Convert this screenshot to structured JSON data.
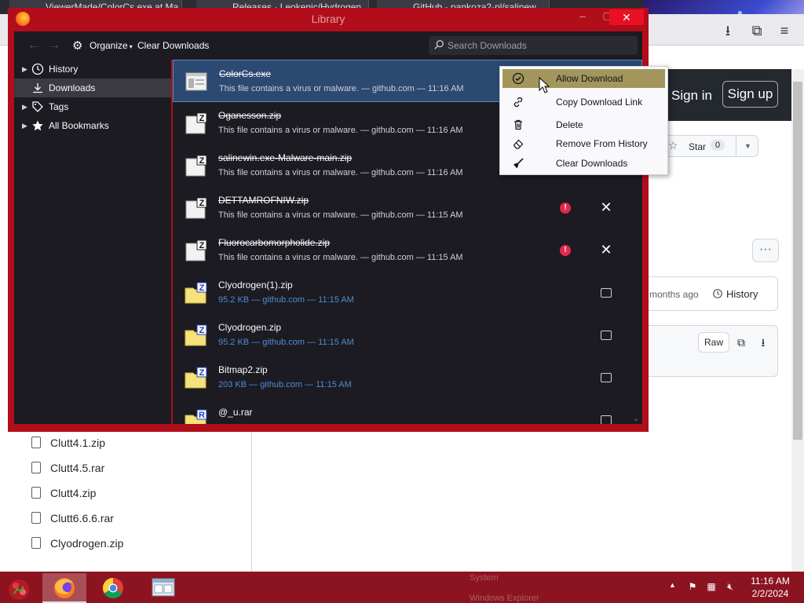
{
  "background_browser": {
    "tabs": [
      "ViewerMade/ColorCs.exe at Ma",
      "Releases · Leokenic/Hydrogen",
      "GitHub - pankoza2-pl/salinew"
    ],
    "sign_in": "Sign in",
    "sign_up": "Sign up",
    "star_label": "Star",
    "star_count": "0",
    "months_ago": "months ago",
    "history_label": "History",
    "raw_label": "Raw",
    "files": [
      "Clutt4.1.zip",
      "Clutt4.5.rar",
      "Clutt4.zip",
      "Clutt6.6.6.rar",
      "Clyodrogen.zip"
    ]
  },
  "library": {
    "title": "Library",
    "toolbar": {
      "organize_label": "Organize",
      "clear_downloads_label": "Clear Downloads",
      "search_placeholder": "Search Downloads"
    },
    "sidebar": [
      {
        "label": "History",
        "icon": "clock-icon",
        "expandable": true
      },
      {
        "label": "Downloads",
        "icon": "download-icon",
        "expandable": false,
        "selected": true
      },
      {
        "label": "Tags",
        "icon": "tag-icon",
        "expandable": true
      },
      {
        "label": "All Bookmarks",
        "icon": "star-icon",
        "expandable": true
      }
    ],
    "downloads": [
      {
        "name": "ColorCs.exe",
        "status": "This file contains a virus or malware. — github.com — 11:16 AM",
        "blocked": true,
        "icon": "exe-file-icon",
        "selected": true
      },
      {
        "name": "Oganesson.zip",
        "status": "This file contains a virus or malware. — github.com — 11:16 AM",
        "blocked": true,
        "icon": "zip-file-icon"
      },
      {
        "name": "salinewin.exe-Malware-main.zip",
        "status": "This file contains a virus or malware. — github.com — 11:16 AM",
        "blocked": true,
        "icon": "zip-file-icon"
      },
      {
        "name": "DETTAMROFNIW.zip",
        "status": "This file contains a virus or malware. — github.com — 11:15 AM",
        "blocked": true,
        "icon": "zip-file-icon"
      },
      {
        "name": "Fluorocarbomorpholide.zip",
        "status": "This file contains a virus or malware. — github.com — 11:15 AM",
        "blocked": true,
        "icon": "zip-file-icon"
      },
      {
        "name": "Clyodrogen(1).zip",
        "status": "95.2 KB — github.com — 11:15 AM",
        "blocked": false,
        "icon": "zip-folder-icon"
      },
      {
        "name": "Clyodrogen.zip",
        "status": "95.2 KB — github.com — 11:15 AM",
        "blocked": false,
        "icon": "zip-folder-icon"
      },
      {
        "name": "Bitmap2.zip",
        "status": "203 KB — github.com — 11:15 AM",
        "blocked": false,
        "icon": "zip-folder-icon"
      },
      {
        "name": "@_u.rar",
        "status": "",
        "blocked": false,
        "icon": "rar-folder-icon"
      }
    ]
  },
  "context_menu": {
    "items": [
      {
        "label": "Allow Download",
        "icon": "check-circle-icon",
        "hover": true
      },
      {
        "label": "Copy Download Link",
        "icon": "link-icon"
      },
      {
        "label": "Delete",
        "icon": "trash-icon"
      },
      {
        "label": "Remove From History",
        "icon": "eraser-icon"
      },
      {
        "label": "Clear Downloads",
        "icon": "broom-icon"
      }
    ]
  },
  "taskbar": {
    "ghost_labels": [
      "System",
      "Windows Explorer"
    ],
    "clock_time": "11:16 AM",
    "clock_date": "2/2/2024"
  },
  "colors": {
    "window_frame": "#b10d1b",
    "taskbar": "#8b1420",
    "menu_hover": "#a3965c",
    "selected_row": "#2b4971",
    "warning": "#e22850"
  }
}
